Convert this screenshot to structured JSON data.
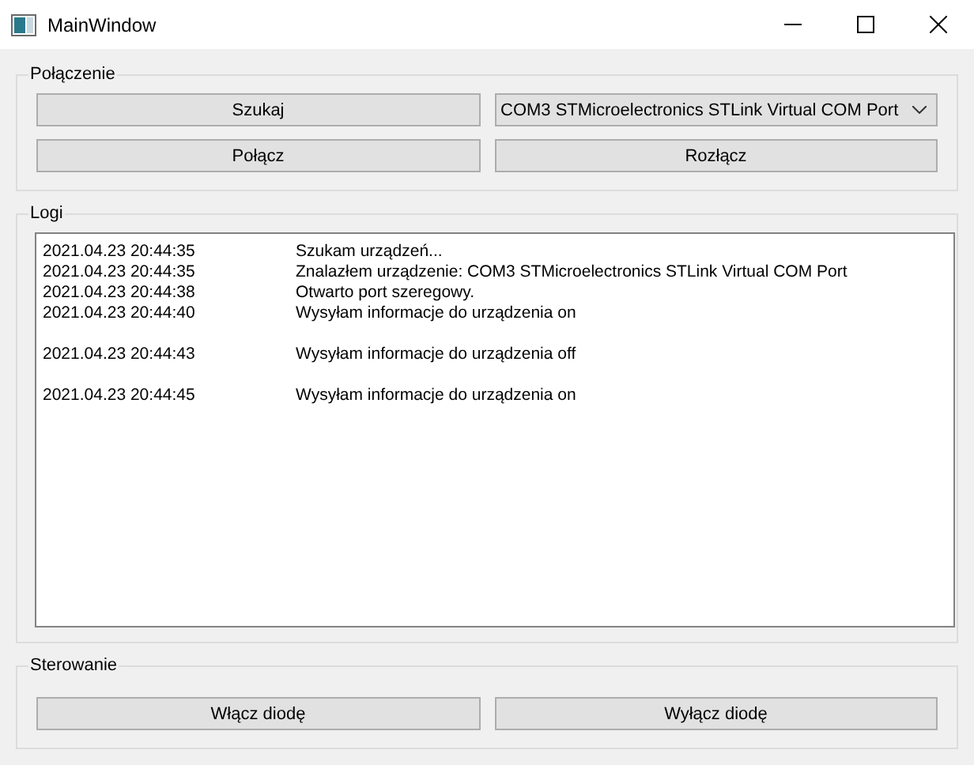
{
  "window": {
    "title": "MainWindow"
  },
  "connection": {
    "title": "Połączenie",
    "search_button": "Szukaj",
    "port_select": {
      "value": "COM3 STMicroelectronics STLink Virtual COM Port"
    },
    "connect_button": "Połącz",
    "disconnect_button": "Rozłącz"
  },
  "logs": {
    "title": "Logi",
    "entries": [
      {
        "kind": "entry",
        "time": "2021.04.23 20:44:35",
        "message": "Szukam urządzeń..."
      },
      {
        "kind": "entry",
        "time": "2021.04.23 20:44:35",
        "message": "Znalazłem urządzenie: COM3 STMicroelectronics STLink Virtual COM Port"
      },
      {
        "kind": "entry",
        "time": "2021.04.23 20:44:38",
        "message": "Otwarto port szeregowy."
      },
      {
        "kind": "entry",
        "time": "2021.04.23 20:44:40",
        "message": "Wysyłam informacje do urządzenia on"
      },
      {
        "kind": "blank"
      },
      {
        "kind": "entry",
        "time": "2021.04.23 20:44:43",
        "message": "Wysyłam informacje do urządzenia off"
      },
      {
        "kind": "blank"
      },
      {
        "kind": "entry",
        "time": "2021.04.23 20:44:45",
        "message": "Wysyłam informacje do urządzenia on"
      }
    ]
  },
  "control": {
    "title": "Sterowanie",
    "buttons": [
      "Włącz diodę",
      "Wyłącz diodę"
    ]
  }
}
